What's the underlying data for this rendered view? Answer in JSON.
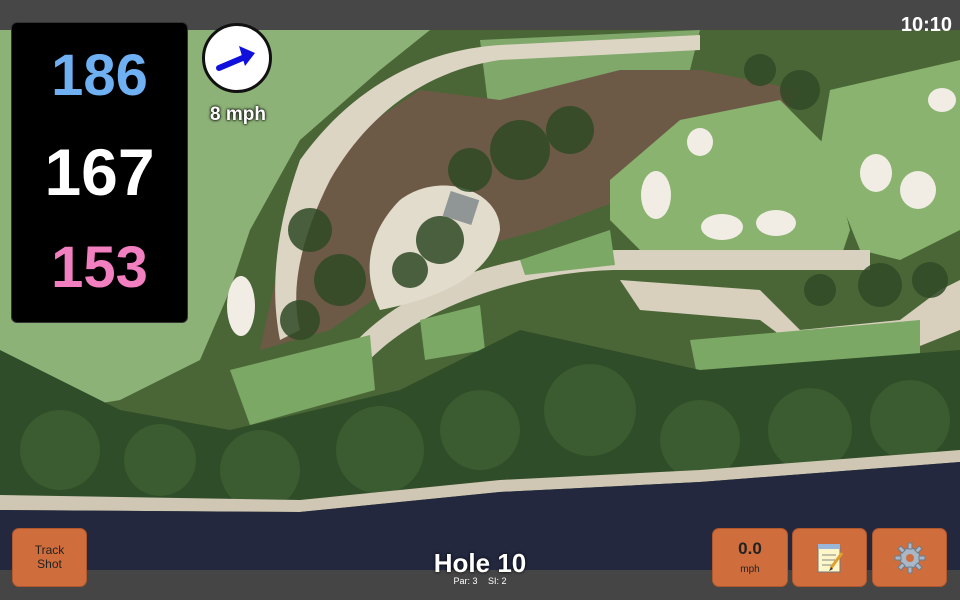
{
  "status": {
    "time": "10:10"
  },
  "distances": {
    "back": "186",
    "middle": "167",
    "front": "153",
    "colors": {
      "back": "#6fb0f2",
      "middle": "#ffffff",
      "front": "#f27fc0"
    }
  },
  "wind": {
    "speed_label": "8 mph",
    "arrow_color": "#1010dd"
  },
  "buttons": {
    "track_shot_line1": "Track",
    "track_shot_line2": "Shot",
    "speed_value": "0.0",
    "speed_unit": "mph",
    "notes_icon": "notepad-icon",
    "settings_icon": "gear-icon",
    "accent_color": "#cf6e3c"
  },
  "hole": {
    "title": "Hole 10",
    "par_label": "Par: 3",
    "si_label": "SI: 2"
  },
  "map": {
    "type": "satellite-golf-course"
  }
}
